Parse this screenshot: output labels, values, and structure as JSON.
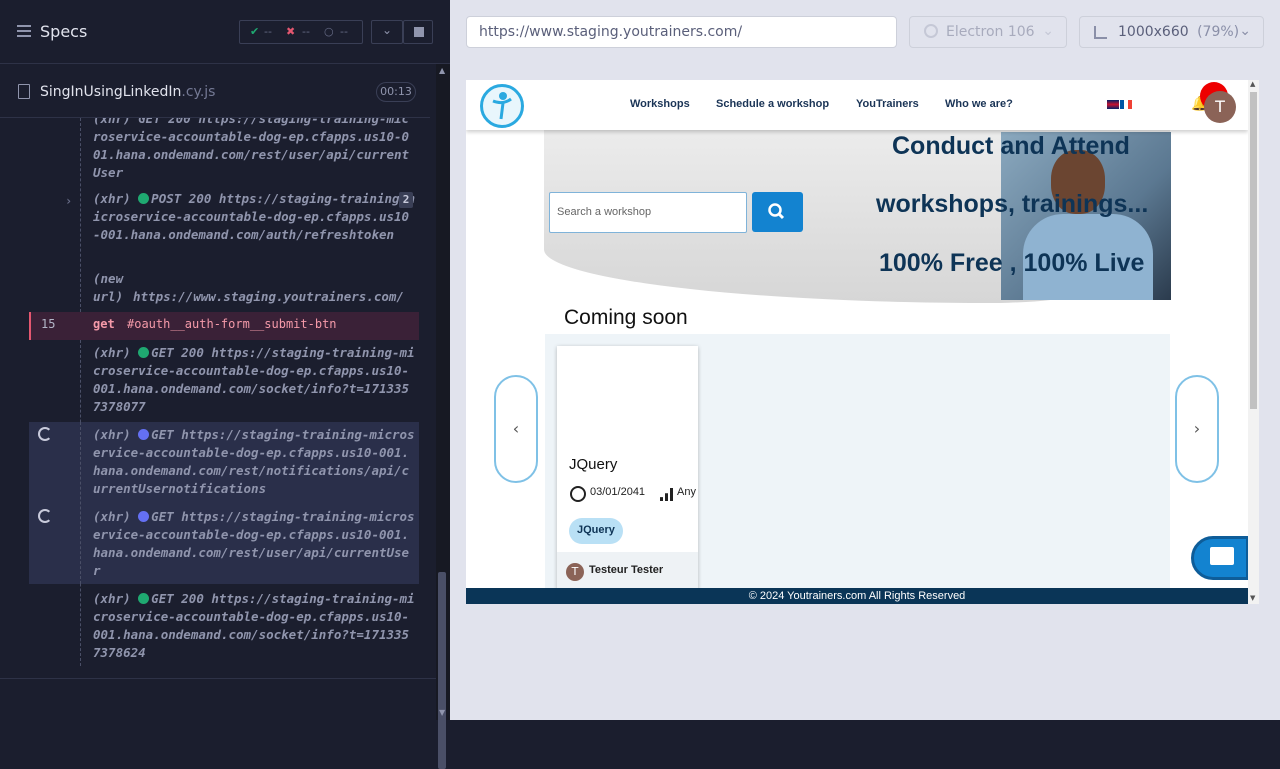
{
  "runner": {
    "title": "Specs",
    "stats": {
      "passed": "--",
      "failed": "--",
      "pending": "--"
    },
    "file": {
      "name": "SingInUsingLinkedIn",
      "ext": ".cy.js",
      "duration": "00:13"
    }
  },
  "log": {
    "entry0": "(xhr)  GET 200 https://staging-training-microservice-accountable-dog-ep.cfapps.us10-001.hana.ondemand.com/rest/user/api/currentUser",
    "entry1_prefix": "(xhr)",
    "entry1": "POST 200 https://staging-training-microservice-accountable-dog-ep.cfapps.us10-001.hana.ondemand.com/auth/refreshtoken",
    "entry1_count": "2",
    "newurl_label1": "(new",
    "newurl_label2": "url)",
    "newurl": "https://www.staging.youtrainers.com/",
    "cmd_num": "15",
    "cmd_name": "get",
    "cmd_arg": "#oauth__auth-form__submit-btn",
    "entry3_prefix": "(xhr)",
    "entry3": "GET 200 https://staging-training-microservice-accountable-dog-ep.cfapps.us10-001.hana.ondemand.com/socket/info?t=1713357378077",
    "entry4_prefix": "(xhr)",
    "entry4": "GET https://staging-training-microservice-accountable-dog-ep.cfapps.us10-001.hana.ondemand.com/rest/notifications/api/currentUsernotifications",
    "entry5_prefix": "(xhr)",
    "entry5": "GET https://staging-training-microservice-accountable-dog-ep.cfapps.us10-001.hana.ondemand.com/rest/user/api/currentUser",
    "entry6_prefix": "(xhr)",
    "entry6": "GET 200 https://staging-training-microservice-accountable-dog-ep.cfapps.us10-001.hana.ondemand.com/socket/info?t=1713357378624"
  },
  "toolbar": {
    "url": "https://www.staging.youtrainers.com/",
    "browser": "Electron 106",
    "viewport": "1000x660",
    "zoom": "(79%)"
  },
  "site": {
    "nav": [
      "Workshops",
      "Schedule a workshop",
      "YouTrainers",
      "Who we are?"
    ],
    "avatar_letter": "T",
    "hero_line1": "Conduct and Attend",
    "hero_line2": "workshops, trainings...",
    "hero_line3": "100% Free , 100% Live",
    "search_placeholder": "Search a workshop",
    "coming_soon": "Coming soon",
    "card": {
      "title": "JQuery",
      "date": "03/01/2041",
      "level": "Any",
      "tag": "JQuery",
      "author": "Testeur Tester",
      "author_initial": "T"
    },
    "footer": "© 2024 Youtrainers.com All Rights Reserved"
  },
  "colors": {
    "accent": "#1383d0",
    "navy": "#0a3557",
    "fail": "#e45770",
    "pass": "#1fa971"
  }
}
